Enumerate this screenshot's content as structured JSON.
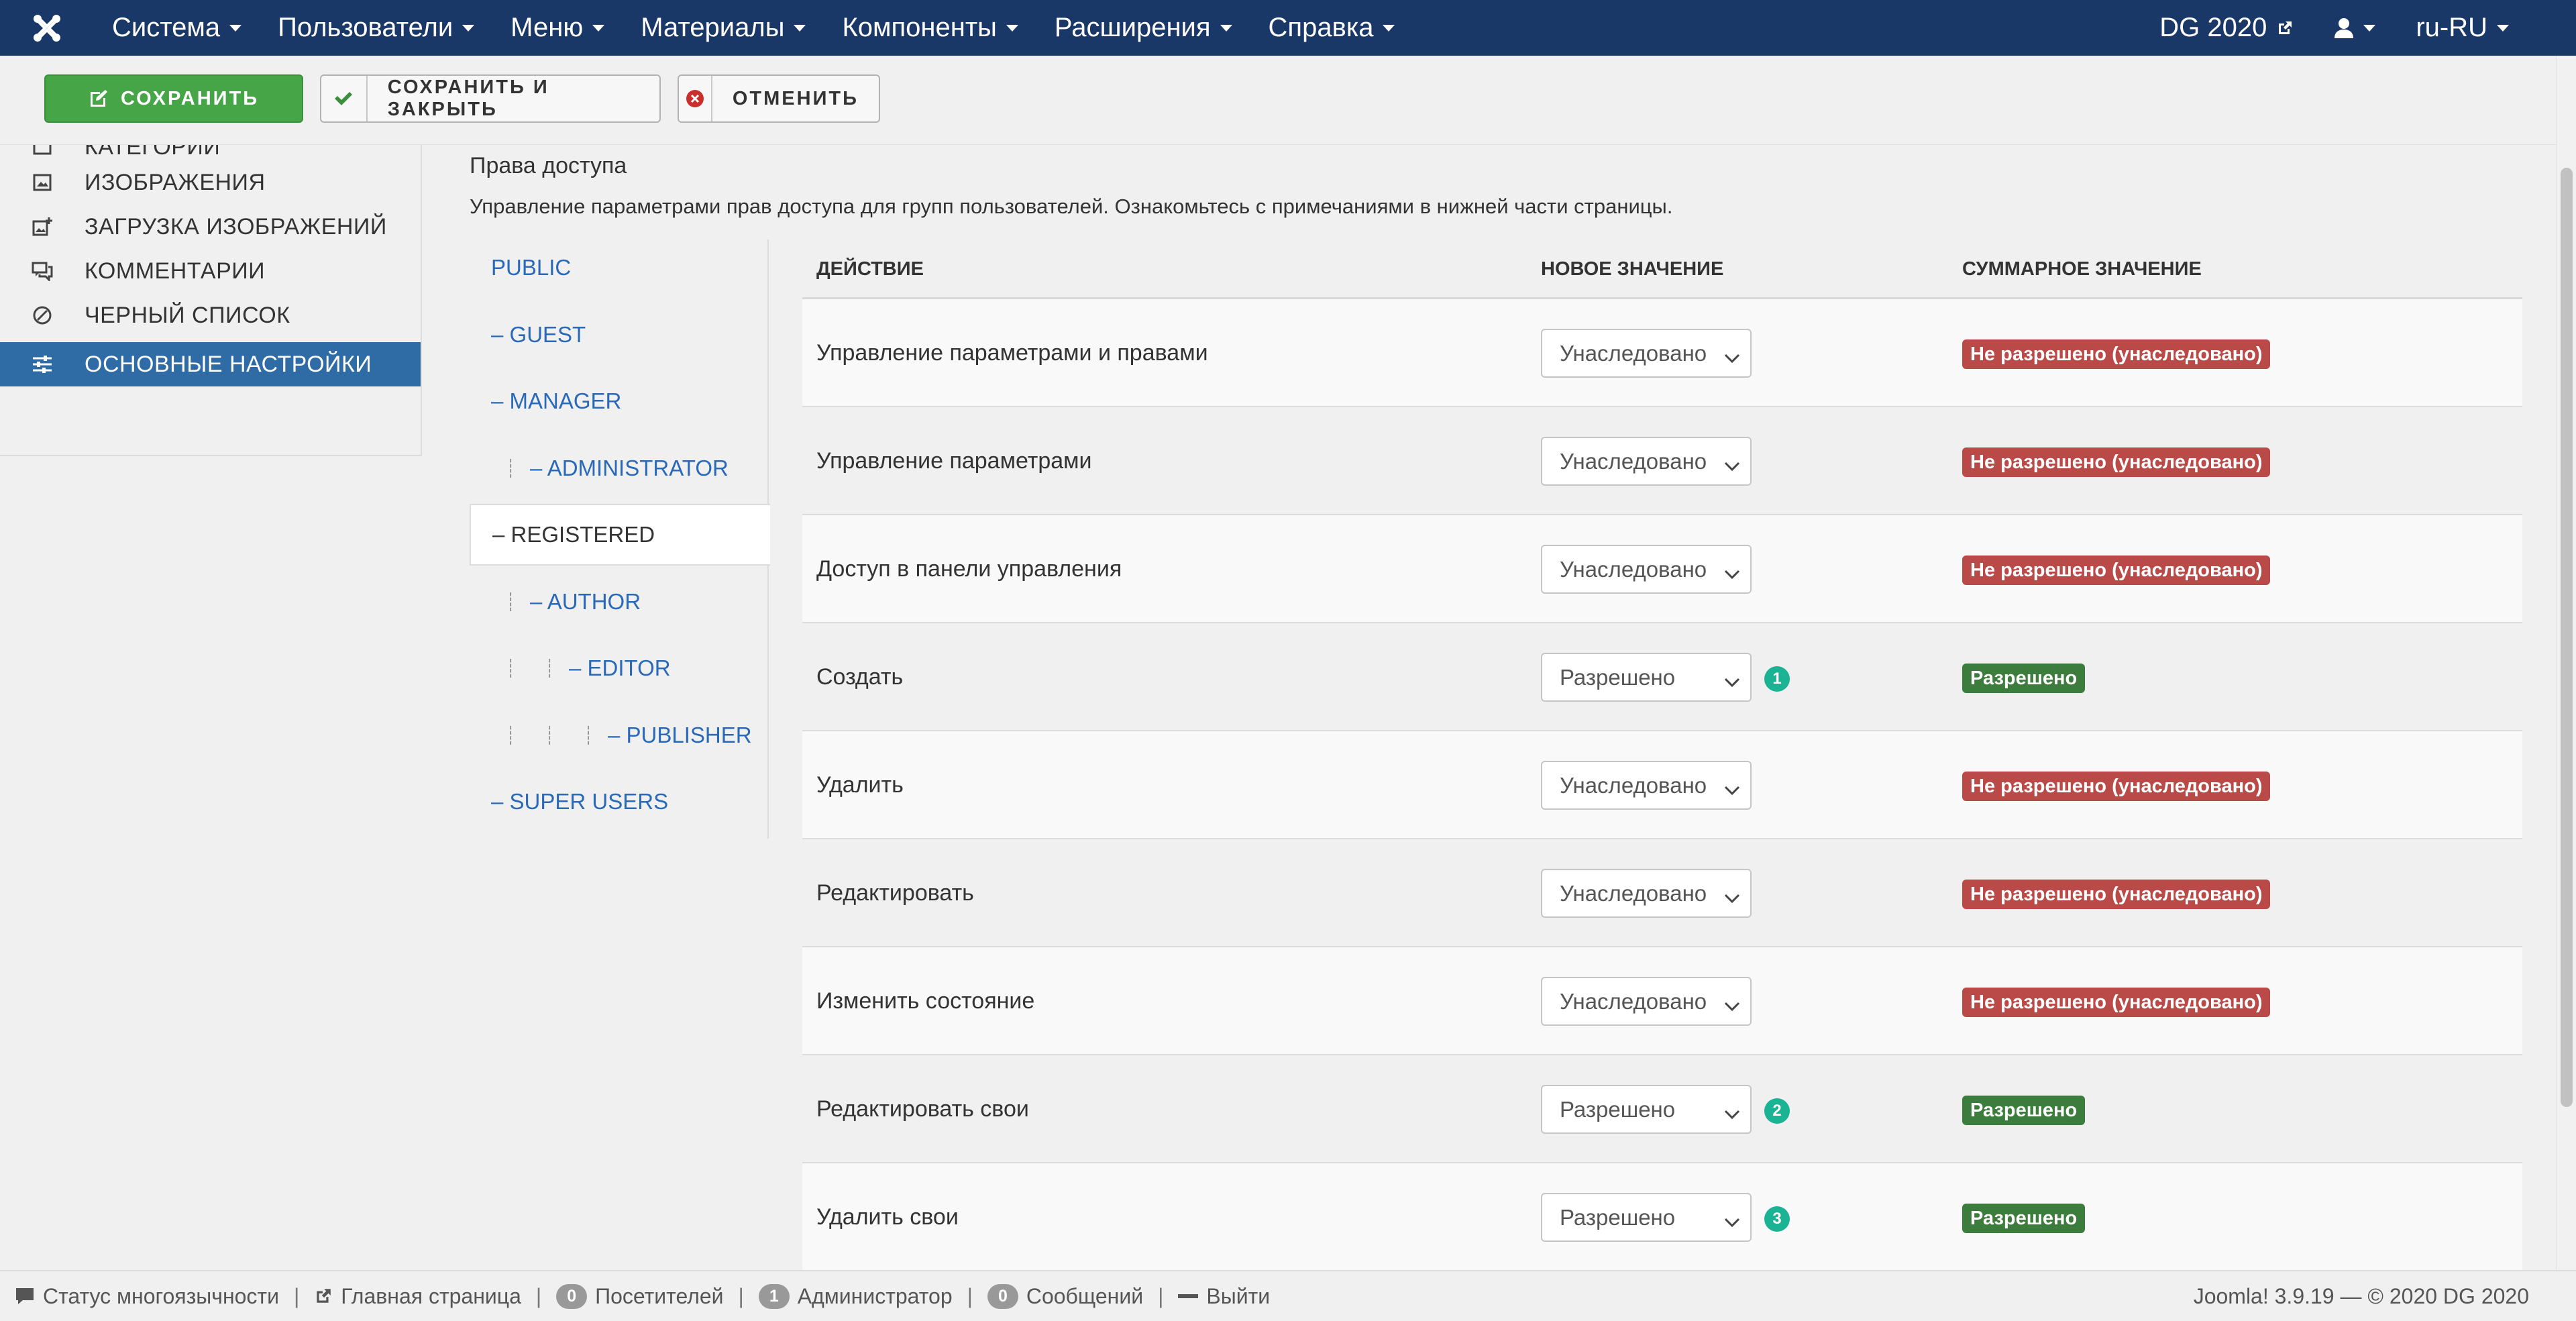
{
  "navbar": {
    "logo_icon": "joomla-logo",
    "menu": [
      "Система",
      "Пользователи",
      "Меню",
      "Материалы",
      "Компоненты",
      "Расширения",
      "Справка"
    ],
    "site_link": "DG 2020",
    "user_icon": "user-icon",
    "language": "ru-RU"
  },
  "toolbar": {
    "save": "СОХРАНИТЬ",
    "save_close": "СОХРАНИТЬ И ЗАКРЫТЬ",
    "cancel": "ОТМЕНИТЬ"
  },
  "sidebar": {
    "items": [
      {
        "label": "КАТЕГОРИИ",
        "icon": "folder-icon"
      },
      {
        "label": "ИЗОБРАЖЕНИЯ",
        "icon": "image-icon"
      },
      {
        "label": "ЗАГРУЗКА ИЗОБРАЖЕНИЙ",
        "icon": "image-upload-icon"
      },
      {
        "label": "КОММЕНТАРИИ",
        "icon": "comments-icon"
      },
      {
        "label": "ЧЕРНЫЙ СПИСОК",
        "icon": "blocked-icon"
      },
      {
        "label": "ОСНОВНЫЕ НАСТРОЙКИ",
        "icon": "options-icon",
        "active": true
      }
    ]
  },
  "main": {
    "title": "Права доступа",
    "description": "Управление параметрами прав доступа для групп пользователей. Ознакомьтесь с примечаниями в нижней части страницы."
  },
  "groups": [
    {
      "label": "PUBLIC",
      "depth": 0
    },
    {
      "label": "– GUEST",
      "depth": 0
    },
    {
      "label": "– MANAGER",
      "depth": 0
    },
    {
      "label": "– ADMINISTRATOR",
      "depth": 1
    },
    {
      "label": "– REGISTERED",
      "depth": 0,
      "active": true
    },
    {
      "label": "– AUTHOR",
      "depth": 1
    },
    {
      "label": "– EDITOR",
      "depth": 2
    },
    {
      "label": "– PUBLISHER",
      "depth": 3
    },
    {
      "label": "– SUPER USERS",
      "depth": 0
    }
  ],
  "table": {
    "headers": {
      "action": "ДЕЙСТВИЕ",
      "new_value": "НОВОЕ ЗНАЧЕНИЕ",
      "calculated": "СУММАРНОЕ ЗНАЧЕНИЕ"
    },
    "rows": [
      {
        "action": "Управление параметрами и правами",
        "value": "Унаследовано",
        "note": "",
        "result": "Не разрешено (унаследовано)",
        "status": "denied"
      },
      {
        "action": "Управление параметрами",
        "value": "Унаследовано",
        "note": "",
        "result": "Не разрешено (унаследовано)",
        "status": "denied"
      },
      {
        "action": "Доступ в панели управления",
        "value": "Унаследовано",
        "note": "",
        "result": "Не разрешено (унаследовано)",
        "status": "denied"
      },
      {
        "action": "Создать",
        "value": "Разрешено",
        "note": "1",
        "result": "Разрешено",
        "status": "allowed"
      },
      {
        "action": "Удалить",
        "value": "Унаследовано",
        "note": "",
        "result": "Не разрешено (унаследовано)",
        "status": "denied"
      },
      {
        "action": "Редактировать",
        "value": "Унаследовано",
        "note": "",
        "result": "Не разрешено (унаследовано)",
        "status": "denied"
      },
      {
        "action": "Изменить состояние",
        "value": "Унаследовано",
        "note": "",
        "result": "Не разрешено (унаследовано)",
        "status": "denied"
      },
      {
        "action": "Редактировать свои",
        "value": "Разрешено",
        "note": "2",
        "result": "Разрешено",
        "status": "allowed"
      },
      {
        "action": "Удалить свои",
        "value": "Разрешено",
        "note": "3",
        "result": "Разрешено",
        "status": "allowed"
      }
    ]
  },
  "statusbar": {
    "multilang": "Статус многоязычности",
    "home": "Главная страница",
    "visitors_count": "0",
    "visitors": "Посетителей",
    "admins_count": "1",
    "admins": "Администратор",
    "messages_count": "0",
    "messages": "Сообщений",
    "logout": "Выйти",
    "version": "Joomla! 3.9.19  —  © 2020 DG 2020"
  },
  "colors": {
    "navbar": "#1a3867",
    "save_button": "#46a546",
    "sidebar_active": "#2f6ca6",
    "link": "#2a69b8",
    "denied_badge": "#b94a48",
    "allowed_badge": "#3c7c3c",
    "note_badge": "#1ab394"
  }
}
